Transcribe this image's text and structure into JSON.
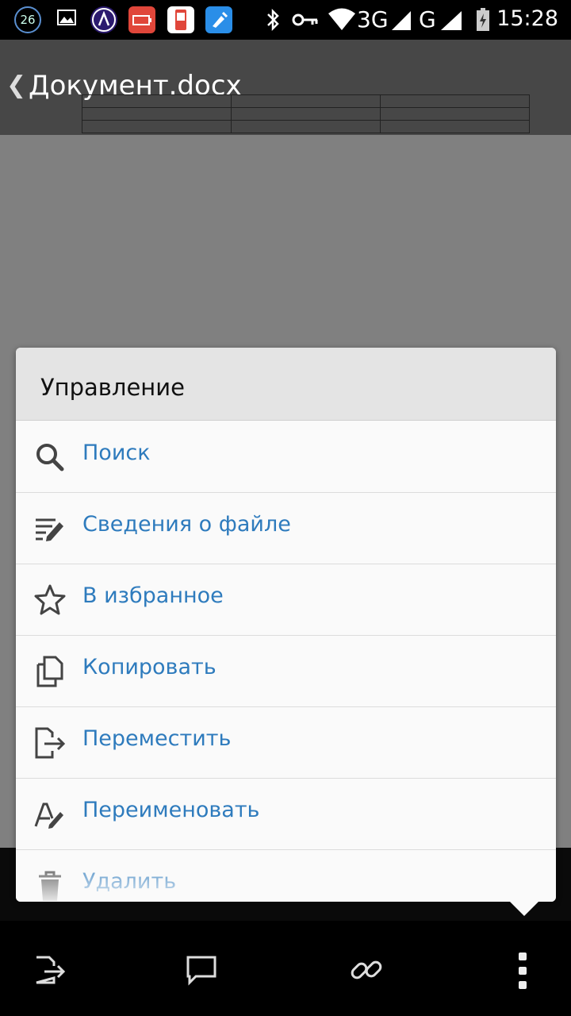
{
  "status_bar": {
    "time": "15:28",
    "network": "3G",
    "network2": "G",
    "notif_count": "26",
    "icons": [
      "notification-count-icon",
      "image-icon",
      "a-app-icon",
      "battery-app-icon",
      "battery-percent-icon",
      "cleaner-icon",
      "bluetooth-icon",
      "vpn-key-icon",
      "wifi-icon",
      "signal-icon",
      "signal2-icon",
      "battery-charging-icon"
    ]
  },
  "header": {
    "back_glyph": "❮",
    "title": "Документ.docx"
  },
  "menu": {
    "title": "Управление",
    "items": [
      {
        "label": "Поиск",
        "icon": "search-icon"
      },
      {
        "label": "Сведения о файле",
        "icon": "file-info-icon"
      },
      {
        "label": "В избранное",
        "icon": "star-icon"
      },
      {
        "label": "Копировать",
        "icon": "copy-icon"
      },
      {
        "label": "Переместить",
        "icon": "move-icon"
      },
      {
        "label": "Переименовать",
        "icon": "rename-icon"
      },
      {
        "label": "Удалить",
        "icon": "trash-icon"
      }
    ]
  },
  "bottom_bar": {
    "icons": [
      "share-icon",
      "comment-icon",
      "link-icon",
      "more-vert-icon"
    ]
  },
  "colors": {
    "accent": "#2e7bbd",
    "header_bg": "#474747",
    "dim_bg": "#808080"
  }
}
